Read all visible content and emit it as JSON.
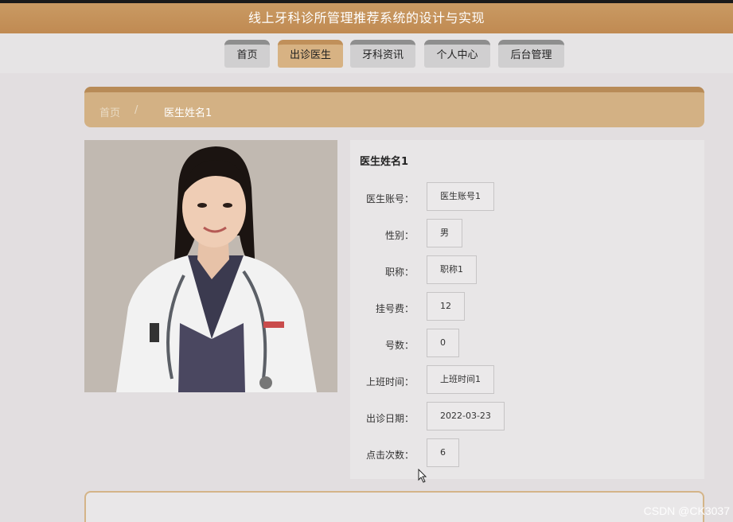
{
  "header": {
    "title": "线上牙科诊所管理推荐系统的设计与实现"
  },
  "nav": {
    "items": [
      {
        "label": "首页",
        "active": false
      },
      {
        "label": "出诊医生",
        "active": true
      },
      {
        "label": "牙科资讯",
        "active": false
      },
      {
        "label": "个人中心",
        "active": false
      },
      {
        "label": "后台管理",
        "active": false
      }
    ]
  },
  "breadcrumb": {
    "home": "首页",
    "separator": "/",
    "current": "医生姓名1"
  },
  "doctor": {
    "name": "医生姓名1",
    "fields": [
      {
        "label": "医生账号：",
        "value": "医生账号1"
      },
      {
        "label": "性别：",
        "value": "男"
      },
      {
        "label": "职称：",
        "value": "职称1"
      },
      {
        "label": "挂号费：",
        "value": "12"
      },
      {
        "label": "号数：",
        "value": "0"
      },
      {
        "label": "上班时间：",
        "value": "上班时间1"
      },
      {
        "label": "出诊日期：",
        "value": "2022-03-23"
      },
      {
        "label": "点击次数：",
        "value": "6"
      }
    ]
  },
  "watermark": "CSDN @CK3037",
  "colors": {
    "header": "#c4915a",
    "accent": "#d3b184",
    "active_tab": "#d7b283"
  }
}
